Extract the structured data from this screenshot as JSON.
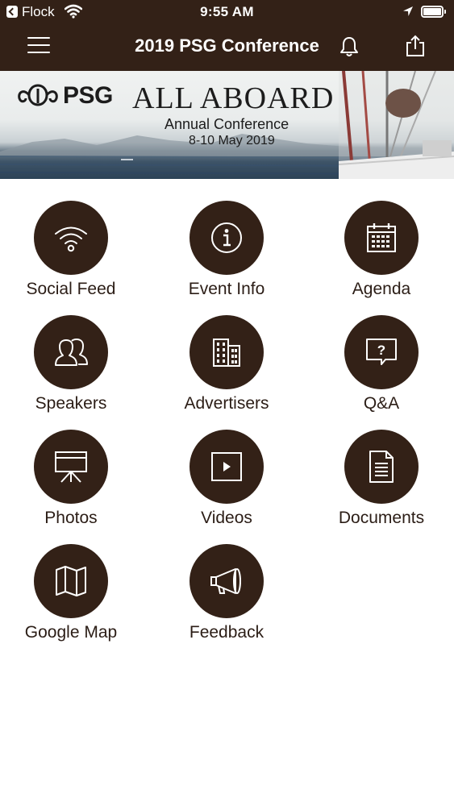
{
  "status_bar": {
    "carrier": "Flock",
    "time": "9:55 AM"
  },
  "nav": {
    "title": "2019 PSG Conference",
    "menu_icon": "hamburger-menu-icon",
    "notification_icon": "bell-icon",
    "share_icon": "share-icon"
  },
  "banner": {
    "logo_text": "PSG",
    "headline": "ALL ABOARD",
    "subtitle": "Annual Conference",
    "dates": "8-10 May 2019"
  },
  "colors": {
    "primary": "#332117",
    "text": "#2b1d16",
    "background": "#ffffff"
  },
  "menu": [
    {
      "label": "Social Feed",
      "icon": "wifi-icon"
    },
    {
      "label": "Event Info",
      "icon": "info-icon"
    },
    {
      "label": "Agenda",
      "icon": "calendar-icon"
    },
    {
      "label": "Speakers",
      "icon": "people-icon"
    },
    {
      "label": "Advertisers",
      "icon": "building-icon"
    },
    {
      "label": "Q&A",
      "icon": "question-bubble-icon"
    },
    {
      "label": "Photos",
      "icon": "presentation-icon"
    },
    {
      "label": "Videos",
      "icon": "play-icon"
    },
    {
      "label": "Documents",
      "icon": "document-icon"
    },
    {
      "label": "Google Map",
      "icon": "map-icon"
    },
    {
      "label": "Feedback",
      "icon": "megaphone-icon"
    }
  ]
}
